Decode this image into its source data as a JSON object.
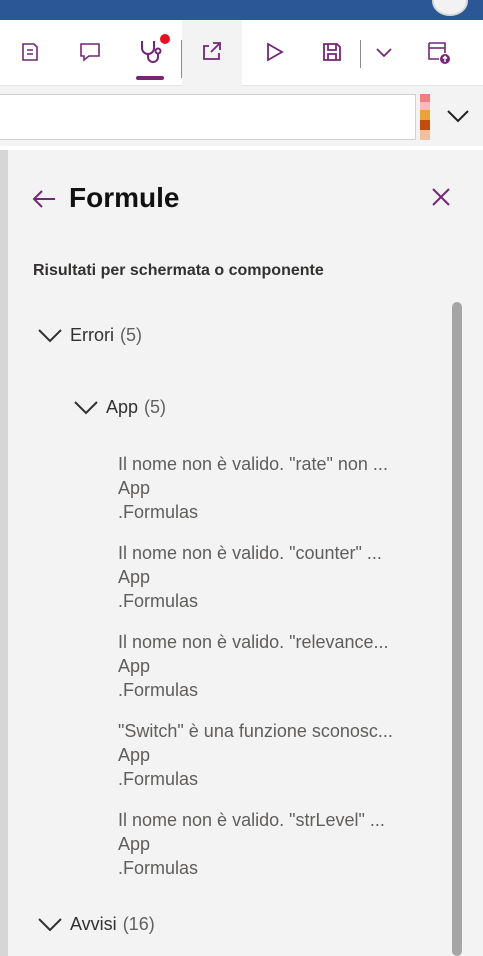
{
  "panel": {
    "title": "Formule",
    "subtitle": "Risultati per schermata o componente"
  },
  "formula_bar": {
    "value": "",
    "colors": [
      "#f08080",
      "#ffb8b8",
      "#e8a33a",
      "#c24b0e",
      "#f0c0a0"
    ]
  },
  "toolbar": {
    "active_tab": "app-checker",
    "accent_color": "#742774",
    "notification_color": "#e81123"
  },
  "groups": {
    "errors": {
      "label": "Errori",
      "count": "(5)"
    },
    "app": {
      "label": "App",
      "count": "(5)"
    },
    "warnings": {
      "label": "Avvisi",
      "count": "(16)"
    }
  },
  "issues": [
    {
      "message": "Il nome non è valido. \"rate\" non ...",
      "location": "App",
      "property": ".Formulas"
    },
    {
      "message": "Il nome non è valido. \"counter\" ...",
      "location": "App",
      "property": ".Formulas"
    },
    {
      "message": "Il nome non è valido. \"relevance...",
      "location": "App",
      "property": ".Formulas"
    },
    {
      "message": "\"Switch\" è una funzione sconosc...",
      "location": "App",
      "property": ".Formulas"
    },
    {
      "message": "Il nome non è valido. \"strLevel\" ...",
      "location": "App",
      "property": ".Formulas"
    }
  ]
}
